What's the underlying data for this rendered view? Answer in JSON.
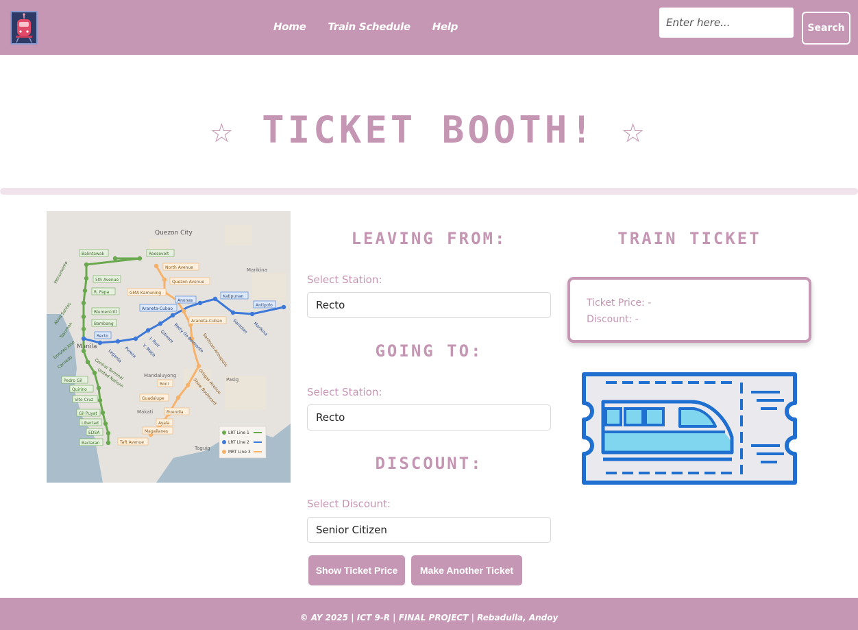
{
  "nav": {
    "links": [
      "Home",
      "Train Schedule",
      "Help"
    ],
    "search_placeholder": "Enter here...",
    "search_label": "Search"
  },
  "hero": {
    "title": "☆ TICKET BOOTH! ☆"
  },
  "map": {
    "labels": {
      "city_quezon": "Quezon City",
      "city_marikina": "Marikina",
      "city_manila": "Manila",
      "city_mandaluyong": "Mandaluyong",
      "city_pasig": "Pasig",
      "city_makati": "Makati",
      "city_taguig": "Taguig"
    },
    "stations_line1": [
      "Balintawak",
      "Roosevelt",
      "Monumento",
      "5th Avenue",
      "R. Papa",
      "Abad Santos",
      "Blumentritt",
      "Tayuman",
      "Bambang",
      "Doroteo Jose",
      "Carriedo",
      "Central Terminal",
      "United Nations",
      "Pedro Gil",
      "Quirino",
      "Vito Cruz",
      "Gil Puyat",
      "Libertad",
      "EDSA",
      "Baclaran"
    ],
    "stations_line2": [
      "Recto",
      "Legarda",
      "Pureza",
      "V. Mapa",
      "J. Ruiz",
      "Gilmore",
      "Betty Go-Belmonte",
      "Araneta-Cubao",
      "Anonas",
      "Katipunan",
      "Santolan",
      "Marikina",
      "Antipolo"
    ],
    "stations_line3": [
      "North Avenue",
      "Quezon Avenue",
      "GMA Kamuning",
      "Araneta-Cubao",
      "Santolan-Annapolis",
      "Ortigas Avenue",
      "Shaw Boulevard",
      "Boni",
      "Guadalupe",
      "Buendia",
      "Ayala",
      "Magallanes",
      "Taft Avenue"
    ],
    "legend": [
      "LRT Line 1",
      "LRT Line 2",
      "MRT Line 3"
    ],
    "colors": {
      "line1": "#6aa84f",
      "line2": "#3c78d8",
      "line3": "#f6b26b"
    }
  },
  "form": {
    "leaving_heading": "LEAVING FROM:",
    "going_heading": "GOING TO:",
    "discount_heading": "DISCOUNT:",
    "select_station_label": "Select Station:",
    "select_discount_label": "Select Discount:",
    "leaving_value": "Recto",
    "going_value": "Recto",
    "discount_value": "Senior Citizen",
    "show_price_label": "Show Ticket Price",
    "another_ticket_label": "Make Another Ticket"
  },
  "ticket": {
    "title": "TRAIN TICKET",
    "price_line": "Ticket Price: -",
    "discount_line": "Discount: -"
  },
  "footer": {
    "text": "© AY 2025 | ICT 9-R | FINAL PROJECT | Rebadulla, Andoy"
  },
  "colors": {
    "accent": "#c597b4",
    "ticket_blue": "#1f6fd1",
    "ticket_light_blue": "#7fd6ee"
  }
}
